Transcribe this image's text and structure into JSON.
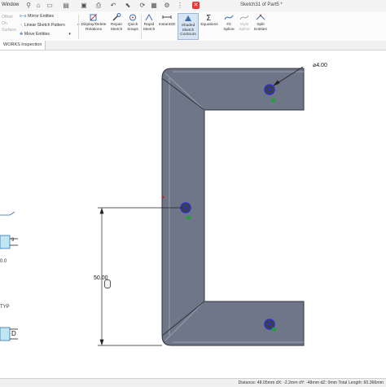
{
  "menu": {
    "window_label": "Window"
  },
  "window_title": "Sketch31 of Part5 *",
  "ribbon": {
    "mirror_entities": "Mirror Entities",
    "linear_sketch_pattern": "Linear Sketch Pattern",
    "move_entities": "Move Entities",
    "offset_on_surface": [
      "Offset",
      "On",
      "Surface"
    ],
    "tools": [
      {
        "label": "Display/Delete Relations"
      },
      {
        "label": "Repair Sketch"
      },
      {
        "label": "Quick Snaps"
      },
      {
        "label": "Rapid Sketch"
      },
      {
        "label": "Instant2D"
      },
      {
        "label": "Shaded Sketch Contours"
      },
      {
        "label": "Equations"
      },
      {
        "label": "Fit Spline"
      },
      {
        "label": "Style Spline"
      },
      {
        "label": "Split Entities"
      }
    ]
  },
  "tab": {
    "label": "WORKS Inspection"
  },
  "canvas": {
    "diameter_label": "⌀4.00",
    "length_label": "50.00",
    "side_labels": [
      "9",
      "0.0",
      "TYP",
      "D"
    ]
  },
  "status": {
    "text": "Distance: 48.05mm   dX: -2.2mm   dY: -48mm   dZ: 0mm Total Length: 60.366mm"
  },
  "colors": {
    "part": "#6f7687",
    "accent": "#d6e4f3",
    "hole": "#2a31c8"
  }
}
